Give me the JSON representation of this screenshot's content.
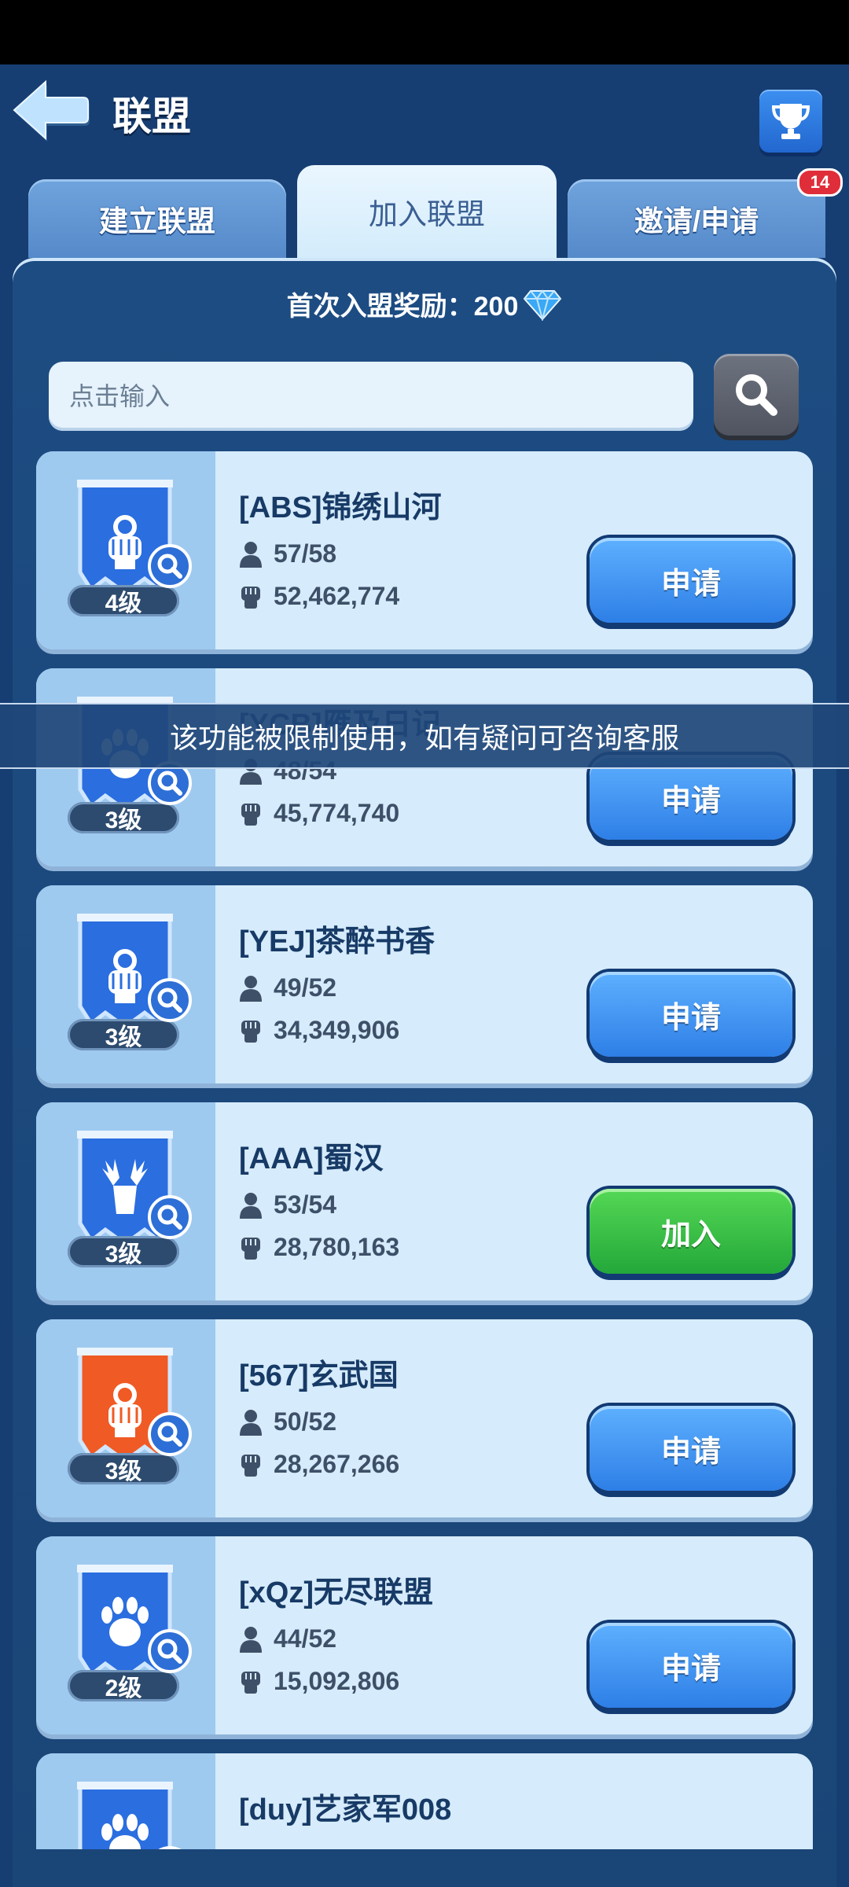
{
  "header": {
    "title": "联盟"
  },
  "tabs": [
    {
      "label": "建立联盟",
      "active": false
    },
    {
      "label": "加入联盟",
      "active": true
    },
    {
      "label": "邀请/申请",
      "active": false,
      "badge": "14"
    }
  ],
  "reward": {
    "label": "首次入盟奖励：200"
  },
  "search": {
    "placeholder": "点击输入"
  },
  "alliances": [
    {
      "name": "[ABS]锦绣山河",
      "level": "4级",
      "members": "57/58",
      "power": "52,462,774",
      "action": "申请",
      "emblem": "gauntlet-emblem",
      "banner_color": "#2a6ee0"
    },
    {
      "name": "[YCB]雁及日记",
      "level": "3级",
      "members": "48/54",
      "power": "45,774,740",
      "action": "申请",
      "emblem": "paw-emblem",
      "banner_color": "#2a6ee0"
    },
    {
      "name": "[YEJ]茶醉书香",
      "level": "3级",
      "members": "49/52",
      "power": "34,349,906",
      "action": "申请",
      "emblem": "gauntlet-emblem",
      "banner_color": "#2a6ee0"
    },
    {
      "name": "[AAA]蜀汉",
      "level": "3级",
      "members": "53/54",
      "power": "28,780,163",
      "action": "加入",
      "emblem": "moose-emblem",
      "banner_color": "#2a6ee0"
    },
    {
      "name": "[567]玄武国",
      "level": "3级",
      "members": "50/52",
      "power": "28,267,266",
      "action": "申请",
      "emblem": "gauntlet-emblem",
      "banner_color": "#f05a25"
    },
    {
      "name": "[xQz]无尽联盟",
      "level": "2级",
      "members": "44/52",
      "power": "15,092,806",
      "action": "申请",
      "emblem": "paw-emblem",
      "banner_color": "#2a6ee0"
    },
    {
      "name": "[duy]艺家军008",
      "level": "",
      "members": "",
      "power": "",
      "action": "",
      "emblem": "paw-emblem",
      "banner_color": "#2a6ee0"
    }
  ],
  "toast": {
    "message": "该功能被限制使用，如有疑问可咨询客服"
  },
  "colors": {
    "apply_button": "#2e7fe6",
    "join_button": "#23a83a",
    "badge": "#e02d3a"
  }
}
